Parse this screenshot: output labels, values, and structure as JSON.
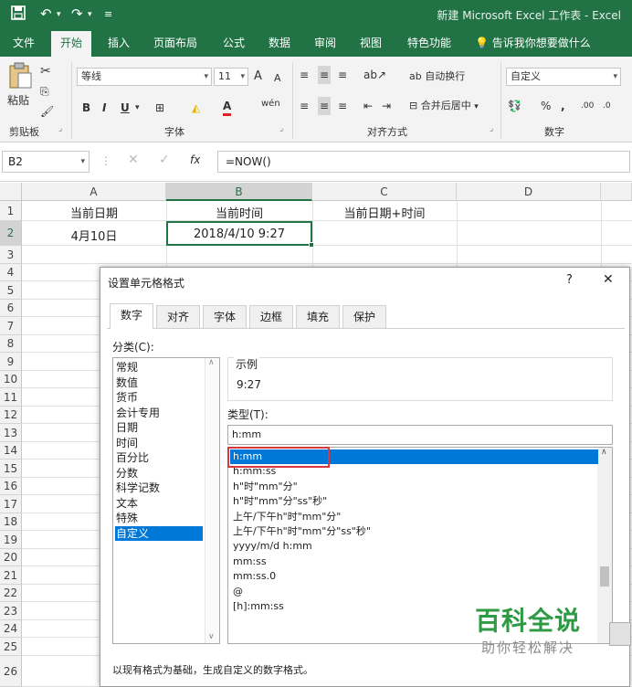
{
  "titlebar": {
    "title": "新建 Microsoft Excel 工作表 - Excel",
    "quick_access": [
      "save-icon",
      "undo-icon",
      "redo-icon",
      "customize-icon"
    ],
    "bg_color": "#217346"
  },
  "ribbon_tabs": [
    "文件",
    "开始",
    "插入",
    "页面布局",
    "公式",
    "数据",
    "审阅",
    "视图",
    "特色功能",
    "告诉我你想要做什么"
  ],
  "ribbon": {
    "paste": "粘贴",
    "clipboard_label": "剪贴板",
    "font_name": "等线",
    "font_size": "11",
    "grow_font": "A",
    "shrink_font": "A",
    "bold": "B",
    "italic": "I",
    "underline": "U",
    "font_color": "A",
    "phonetic": "wén",
    "font_label": "字体",
    "wrap_text": "自动换行",
    "merge_center": "合并后居中",
    "alignment_label": "对齐方式",
    "number_format": "自定义",
    "percent": "%",
    "comma": ",",
    "number_label": "数字"
  },
  "formula_bar": {
    "name_box": "B2",
    "fx": "fx",
    "formula": "=NOW()"
  },
  "grid": {
    "columns": [
      "A",
      "B",
      "C",
      "D"
    ],
    "rows": [
      "1",
      "2",
      "3",
      "4",
      "5",
      "6",
      "7",
      "8",
      "9",
      "10",
      "11",
      "12",
      "13",
      "14",
      "15",
      "16",
      "17",
      "18",
      "19",
      "20",
      "21",
      "22",
      "23",
      "24",
      "25",
      "26"
    ],
    "cells": {
      "A1": "当前日期",
      "B1": "当前时间",
      "C1": "当前日期+时间",
      "A2": "4月10日",
      "B2": "2018/4/10 9:27"
    }
  },
  "dialog": {
    "title": "设置单元格格式",
    "help": "?",
    "close": "✕",
    "tabs": [
      "数字",
      "对齐",
      "字体",
      "边框",
      "填充",
      "保护"
    ],
    "category_label": "分类(C):",
    "categories": [
      "常规",
      "数值",
      "货币",
      "会计专用",
      "日期",
      "时间",
      "百分比",
      "分数",
      "科学记数",
      "文本",
      "特殊",
      "自定义"
    ],
    "selected_category": "自定义",
    "sample_label": "示例",
    "sample_value": "9:27",
    "type_label": "类型(T):",
    "type_value": "h:mm",
    "formats": [
      "h:mm",
      "h:mm:ss",
      "h\"时\"mm\"分\"",
      "h\"时\"mm\"分\"ss\"秒\"",
      "上午/下午h\"时\"mm\"分\"",
      "上午/下午h\"时\"mm\"分\"ss\"秒\"",
      "yyyy/m/d h:mm",
      "mm:ss",
      "mm:ss.0",
      "@",
      "[h]:mm:ss"
    ],
    "selected_format": "h:mm",
    "description": "以现有格式为基础，生成自定义的数字格式。",
    "highlight_color": "#d9363e"
  },
  "watermark": {
    "title": "百科全说",
    "subtitle": "助你轻松解决"
  }
}
